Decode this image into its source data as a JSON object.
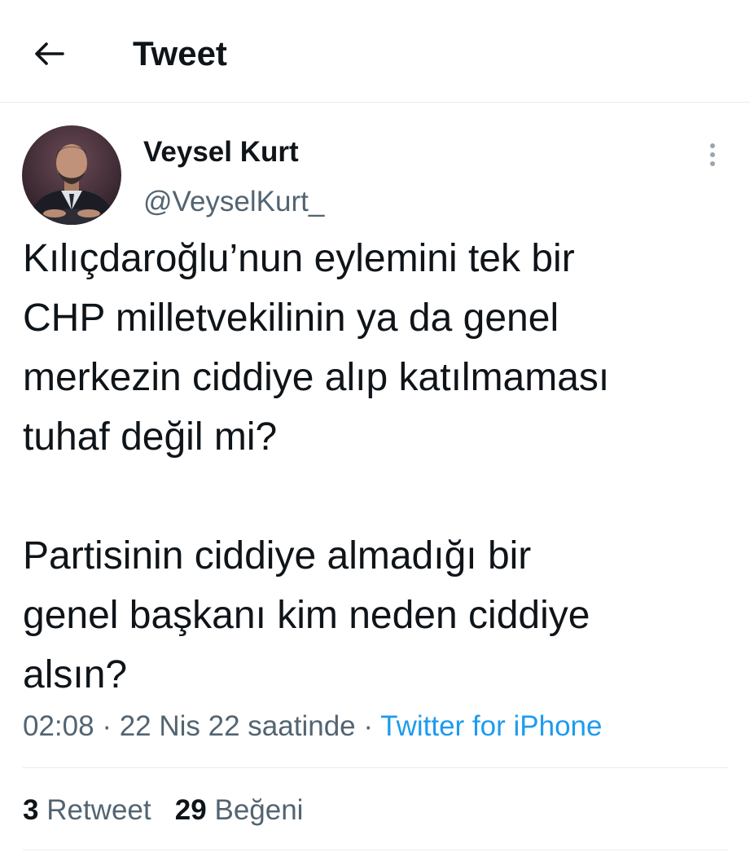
{
  "header": {
    "title": "Tweet",
    "back_icon": "arrow-left-icon"
  },
  "author": {
    "name": "Veysel Kurt",
    "handle": "@VeyselKurt_",
    "avatar_icon": "profile-photo"
  },
  "tweet": {
    "lines_paragraph_1": [
      "Kılıçdaroğlu’nun eylemini tek bir",
      "CHP milletvekilinin ya da genel",
      "merkezin ciddiye alıp katılmaması",
      "tuhaf değil mi?"
    ],
    "lines_paragraph_2": [
      "Partisinin ciddiye almadığı bir",
      "genel başkanı kim neden ciddiye",
      "alsın?"
    ]
  },
  "meta": {
    "time": "02:08",
    "separator": "·",
    "date": "22 Nis 22 saatinde",
    "source": "Twitter for iPhone"
  },
  "stats": {
    "retweet_count": "3",
    "retweet_label": "Retweet",
    "like_count": "29",
    "like_label": "Beğeni"
  },
  "colors": {
    "text": "#0f1419",
    "secondary": "#536471",
    "accent": "#1d9bf0",
    "divider": "#e6ecf0"
  }
}
